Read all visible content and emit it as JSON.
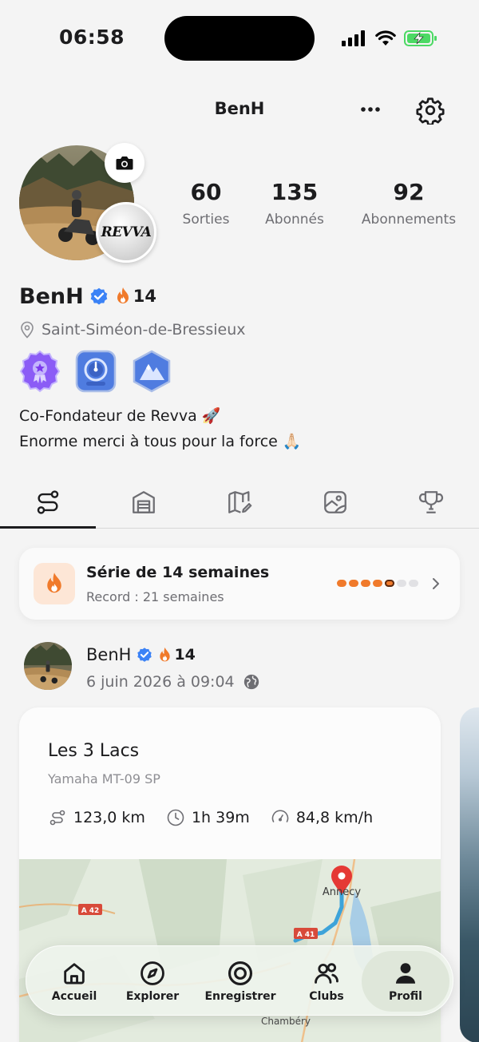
{
  "status_bar": {
    "time": "06:58"
  },
  "header": {
    "title": "BenH"
  },
  "profile": {
    "club_logo_text": "REVVA",
    "stats": [
      {
        "value": "60",
        "label": "Sorties"
      },
      {
        "value": "135",
        "label": "Abonnés"
      },
      {
        "value": "92",
        "label": "Abonnements"
      }
    ],
    "name": "BenH",
    "streak": "14",
    "location": "Saint-Siméon-de-Bressieux",
    "bio_line1": "Co-Fondateur de Revva 🚀",
    "bio_line2": "Enorme merci à tous pour la force 🙏🏻"
  },
  "tabs": [
    {
      "icon": "route-icon",
      "active": true
    },
    {
      "icon": "garage-icon",
      "active": false
    },
    {
      "icon": "map-edit-icon",
      "active": false
    },
    {
      "icon": "image-icon",
      "active": false
    },
    {
      "icon": "trophy-icon",
      "active": false
    }
  ],
  "streak_card": {
    "title": "Série de 14 semaines",
    "record": "Record : 21 semaines",
    "dots_filled": 5,
    "dots_total": 7
  },
  "post": {
    "author": "BenH",
    "streak": "14",
    "date": "6 juin 2026 à 09:04"
  },
  "ride": {
    "title": "Les 3 Lacs",
    "bike": "Yamaha MT-09 SP",
    "distance": "123,0 km",
    "duration": "1h 39m",
    "speed": "84,8 km/h"
  },
  "map": {
    "label_city": "Annecy",
    "label_road1": "A 42",
    "label_road2": "A 41",
    "label_city2": "Chambéry"
  },
  "tab_bar": {
    "items": [
      {
        "label": "Accueil"
      },
      {
        "label": "Explorer"
      },
      {
        "label": "Enregistrer"
      },
      {
        "label": "Clubs"
      },
      {
        "label": "Profil"
      }
    ]
  },
  "colors": {
    "accent_orange": "#f07a2b",
    "verified_blue": "#3b82f6",
    "route_blue": "#3da3d9",
    "pin_red": "#e53935"
  }
}
